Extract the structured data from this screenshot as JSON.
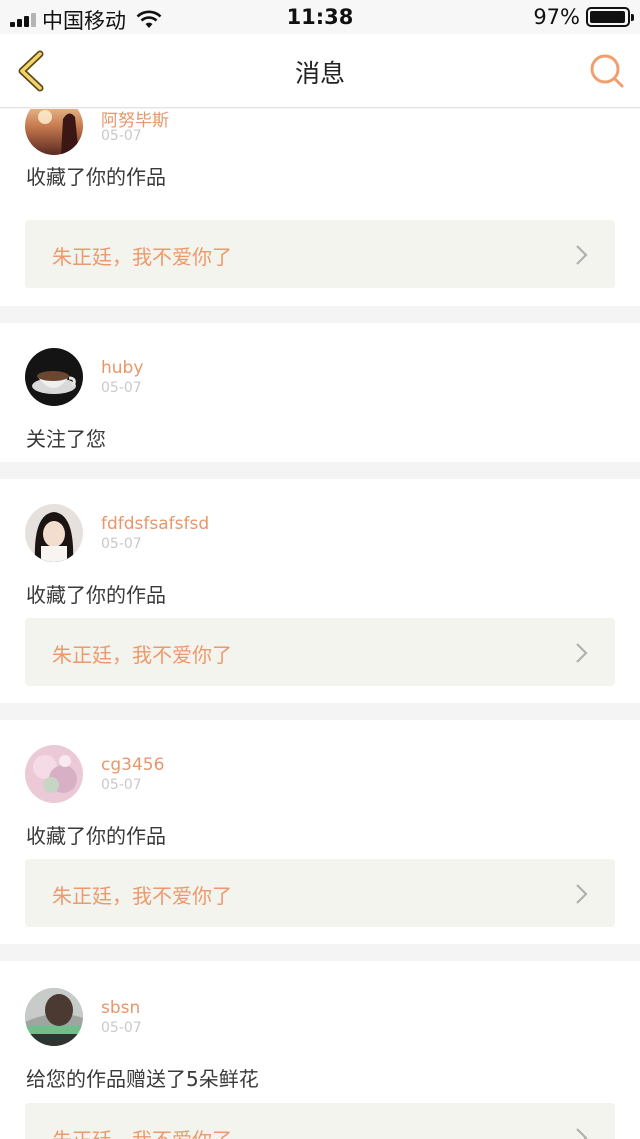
{
  "status": {
    "carrier": "中国移动",
    "time": "11:38",
    "battery": "97%",
    "battery_level": 0.97,
    "icons": [
      "signal-icon",
      "wifi-icon",
      "battery-icon"
    ]
  },
  "nav": {
    "title": "消息",
    "back_icon": "chevron-left-icon",
    "search_icon": "search-icon",
    "accent": "#f0a070"
  },
  "messages": [
    {
      "user": "阿努毕斯",
      "date": "05-07",
      "action": "收藏了你的作品",
      "work": "朱正廷，我不爱你了"
    },
    {
      "user": "huby",
      "date": "05-07",
      "action": "关注了您"
    },
    {
      "user": "fdfdsfsafsfsd",
      "date": "05-07",
      "action": "收藏了你的作品",
      "work": "朱正廷，我不爱你了"
    },
    {
      "user": "cg3456",
      "date": "05-07",
      "action": "收藏了你的作品",
      "work": "朱正廷，我不爱你了"
    },
    {
      "user": "sbsn",
      "date": "05-07",
      "action": "给您的作品赠送了5朵鲜花",
      "work": "朱正廷，我不爱你了"
    }
  ],
  "colors": {
    "username": "#e8966a",
    "work_title": "#ec9a6c",
    "date": "#c9c9c9",
    "work_bg": "#f4f4ef"
  }
}
